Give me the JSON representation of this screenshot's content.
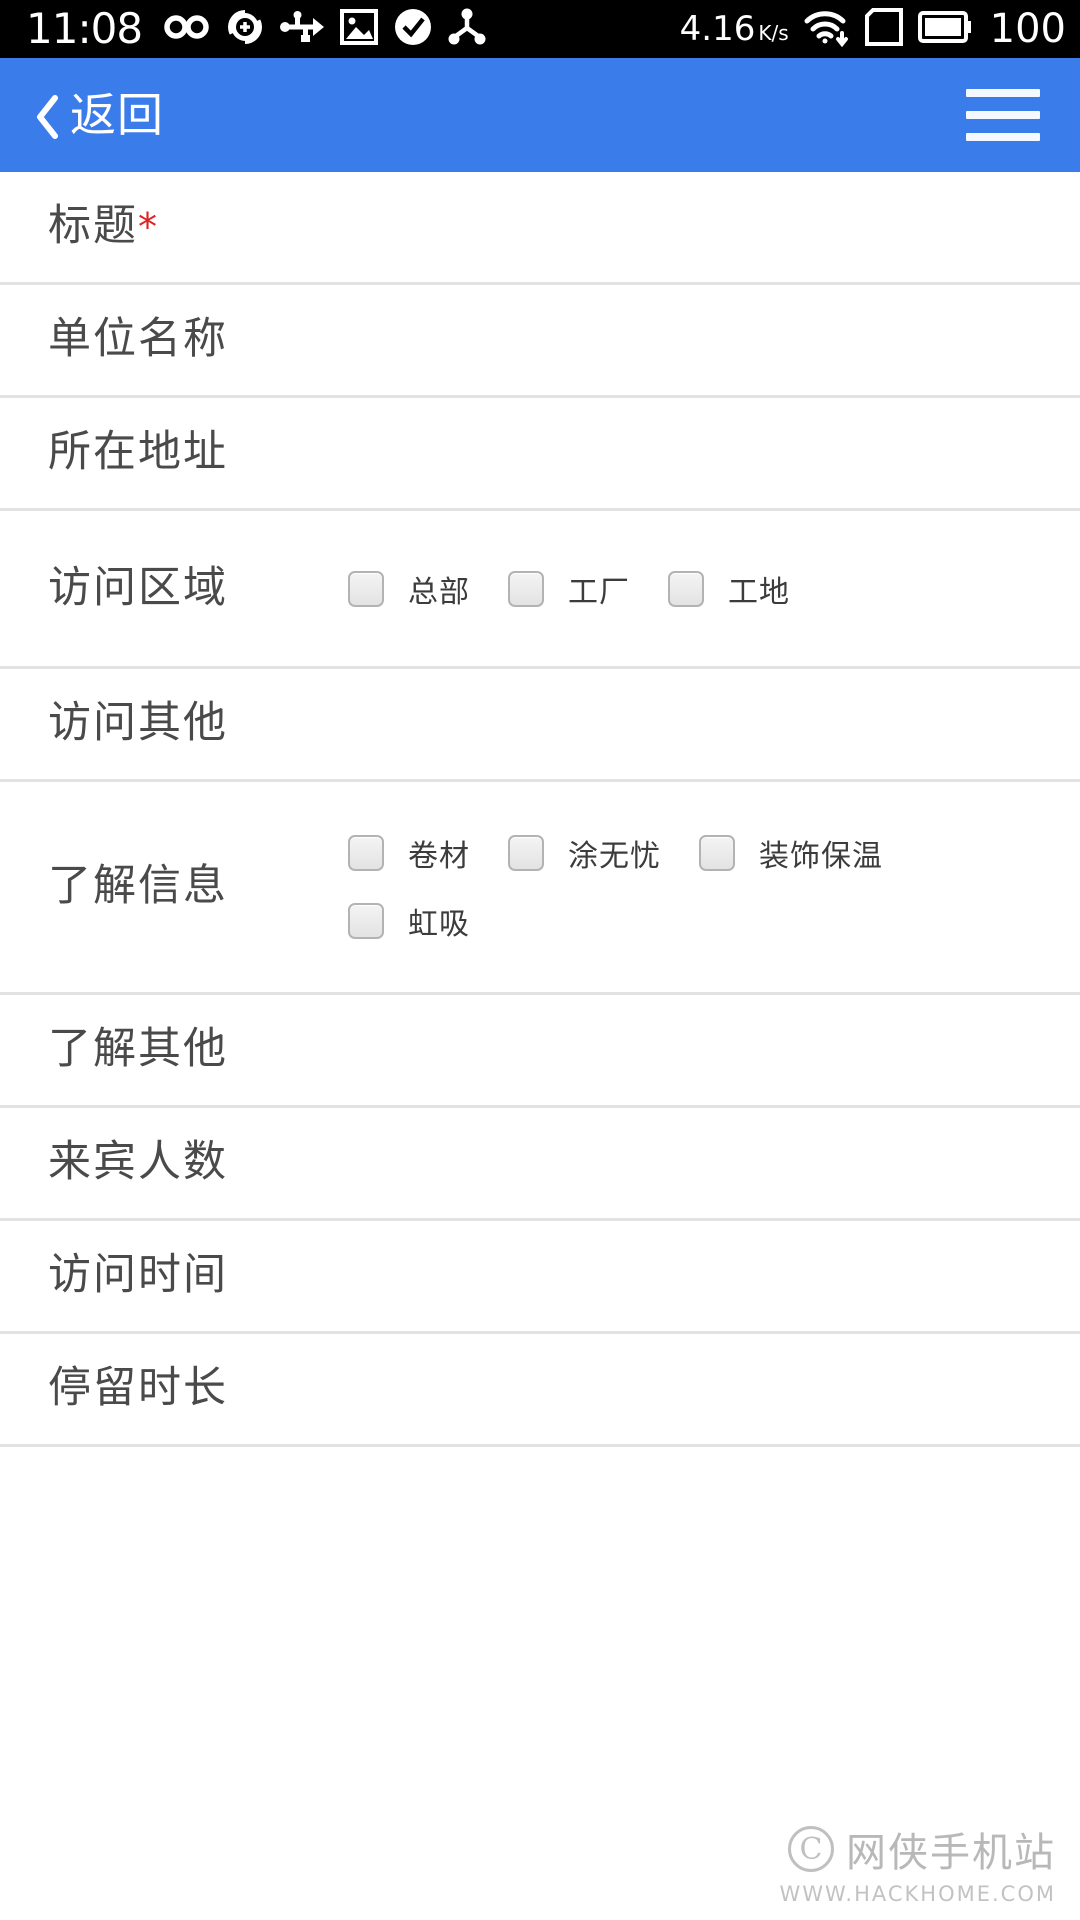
{
  "statusbar": {
    "time": "11:08",
    "left_icons": [
      {
        "name": "infinity-icon",
        "glyph": "∞"
      },
      {
        "name": "sync-add-icon",
        "glyph": "⊕"
      },
      {
        "name": "usb-icon",
        "glyph": "usb"
      },
      {
        "name": "image-icon",
        "glyph": "image"
      },
      {
        "name": "check-circle-icon",
        "glyph": "✔"
      },
      {
        "name": "share-icon",
        "glyph": "share"
      }
    ],
    "network_speed": "4.16",
    "network_speed_unit": "K/s",
    "wifi_icon": "wifi-download-icon",
    "sim_icon": "sim-card-icon",
    "battery_icon": "battery-full-icon",
    "battery_level": "100"
  },
  "appbar": {
    "back_label": "返回",
    "back_icon": "chevron-left-icon",
    "menu_icon": "hamburger-menu-icon",
    "accent_color": "#3b7ceb"
  },
  "form": {
    "rows": [
      {
        "label": "标题",
        "required": true,
        "value": "",
        "type": "text"
      },
      {
        "label": "单位名称",
        "required": false,
        "value": "",
        "type": "text"
      },
      {
        "label": "所在地址",
        "required": false,
        "value": "",
        "type": "text"
      },
      {
        "label": "访问区域",
        "required": false,
        "type": "checkbox",
        "options": [
          {
            "label": "总部",
            "checked": false
          },
          {
            "label": "工厂",
            "checked": false
          },
          {
            "label": "工地",
            "checked": false
          }
        ]
      },
      {
        "label": "访问其他",
        "required": false,
        "value": "",
        "type": "text"
      },
      {
        "label": "了解信息",
        "required": false,
        "type": "checkbox",
        "options": [
          {
            "label": "卷材",
            "checked": false
          },
          {
            "label": "涂无忧",
            "checked": false
          },
          {
            "label": "装饰保温",
            "checked": false
          },
          {
            "label": "虹吸",
            "checked": false
          }
        ]
      },
      {
        "label": "了解其他",
        "required": false,
        "value": "",
        "type": "text"
      },
      {
        "label": "来宾人数",
        "required": false,
        "value": "",
        "type": "text"
      },
      {
        "label": "访问时间",
        "required": false,
        "value": "",
        "type": "text"
      },
      {
        "label": "停留时长",
        "required": false,
        "value": "",
        "type": "text"
      }
    ]
  },
  "watermark": {
    "badge": "C",
    "name": "网侠手机站",
    "url": "WWW.HACKHOME.COM"
  }
}
